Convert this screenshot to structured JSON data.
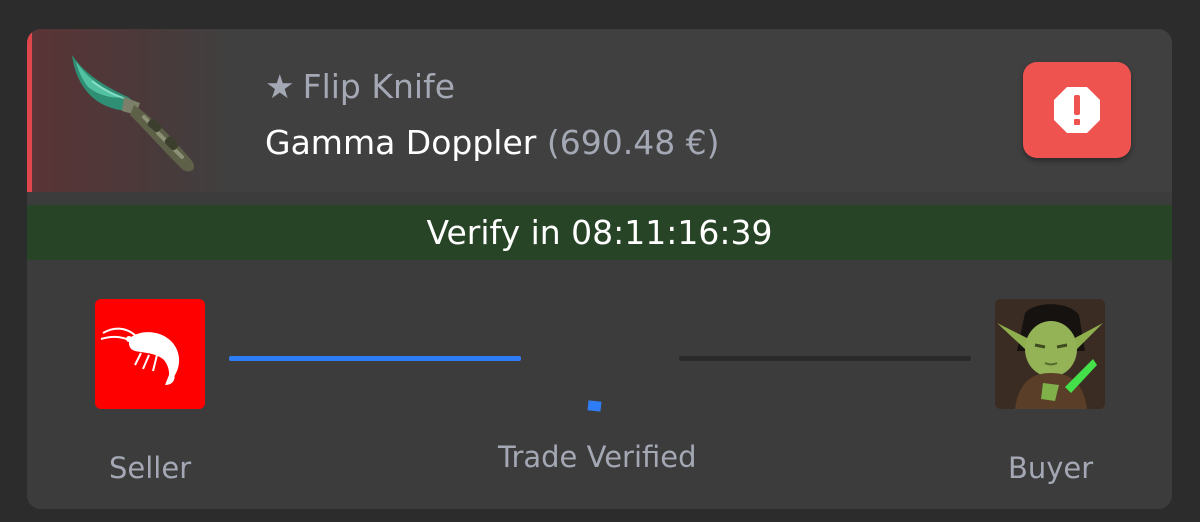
{
  "item": {
    "star": "★",
    "name": "Flip Knife",
    "finish": "Gamma Doppler",
    "price": "(690.48 €)",
    "rarity_color": "#e0474c",
    "image_icon": "flip-knife-icon"
  },
  "actions": {
    "report_icon": "alert-octagon-icon",
    "report_color": "#ef5350"
  },
  "timer": {
    "text": "Verify in 08:11:16:39",
    "bg_color": "#284426"
  },
  "trade": {
    "seller": {
      "label": "Seller",
      "avatar_icon": "shrimp-icon"
    },
    "buyer": {
      "label": "Buyer",
      "avatar_icon": "yoda-avatar"
    },
    "status": "Trade Verified",
    "progress_left": 1.0,
    "progress_right": 0.0,
    "accent_color": "#2f7df6"
  }
}
